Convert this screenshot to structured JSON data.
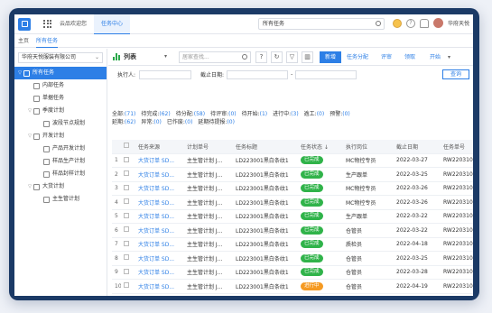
{
  "topbar": {
    "tabs": [
      "云品欢迎您",
      "任务中心"
    ],
    "search_value": "所有任务",
    "user_name": "华府天悦"
  },
  "subnav": {
    "items": [
      "主页",
      "所有任务"
    ]
  },
  "sidebar": {
    "company": "华府天悦服装有限公司",
    "tree": [
      {
        "label": "所有任务",
        "level": 0,
        "caret": "▽",
        "selected": true
      },
      {
        "label": "内部任务",
        "level": 1,
        "caret": ""
      },
      {
        "label": "单据任务",
        "level": 1,
        "caret": ""
      },
      {
        "label": "季度计划",
        "level": 1,
        "caret": "▽"
      },
      {
        "label": "波段节点规划",
        "level": 2,
        "caret": ""
      },
      {
        "label": "开发计划",
        "level": 1,
        "caret": "▽"
      },
      {
        "label": "产品开发计划",
        "level": 2,
        "caret": ""
      },
      {
        "label": "样品生产计划",
        "level": 2,
        "caret": ""
      },
      {
        "label": "样品封样计划",
        "level": 2,
        "caret": ""
      },
      {
        "label": "大货计划",
        "level": 1,
        "caret": "▽"
      },
      {
        "label": "主生管计划",
        "level": 2,
        "caret": ""
      }
    ]
  },
  "toolbar": {
    "title": "列表",
    "search_placeholder": "居家查找...",
    "new_label": "新增",
    "assign_label": "任务分配",
    "review_label": "评审",
    "claim_label": "领取",
    "start_label": "开始"
  },
  "filters": {
    "executor_label": "执行人:",
    "deadline_label": "截止日期:",
    "query_label": "查询"
  },
  "stats": {
    "row1": [
      "全部:",
      "(71)",
      "待完成:",
      "(62)",
      "待分配:",
      "(58)",
      "待评审:",
      "(0)",
      "待开始:",
      "(1)",
      "进行中:",
      "(3)",
      "逾工:",
      "(0)",
      "预警:",
      "(0)"
    ],
    "row2": [
      "延期:",
      "(62)",
      "异常:",
      "(0)",
      "已作废:",
      "(0)",
      "延期待提报:",
      "(0)"
    ]
  },
  "table": {
    "headers": [
      "",
      "",
      "任务来源",
      "计划单号",
      "任务标题",
      "任务状态 ↓",
      "执行岗位",
      "截止日期",
      "任务单号"
    ],
    "rows": [
      {
        "n": "1",
        "src": "大货订单 SD...",
        "plan": "主生管计划 J...",
        "title": "LD223001黑白条纹1",
        "status": "已完成",
        "pos": "MC物控专员",
        "date": "2022-03-27",
        "no": "RW2203100"
      },
      {
        "n": "2",
        "src": "大货订单 SD...",
        "plan": "主生管计划 J...",
        "title": "LD223001黑白条纹1",
        "status": "已完成",
        "pos": "生产跟单",
        "date": "2022-03-25",
        "no": "RW2203100"
      },
      {
        "n": "3",
        "src": "大货订单 SD...",
        "plan": "主生管计划 J...",
        "title": "LD223001黑白条纹1",
        "status": "已完成",
        "pos": "MC物控专员",
        "date": "2022-03-26",
        "no": "RW2203100"
      },
      {
        "n": "4",
        "src": "大货订单 SD...",
        "plan": "主生管计划 J...",
        "title": "LD223001黑白条纹1",
        "status": "已完成",
        "pos": "MC物控专员",
        "date": "2022-03-26",
        "no": "RW2203100"
      },
      {
        "n": "5",
        "src": "大货订单 SD...",
        "plan": "主生管计划 J...",
        "title": "LD223001黑白条纹1",
        "status": "已完成",
        "pos": "生产跟单",
        "date": "2022-03-22",
        "no": "RW2203100"
      },
      {
        "n": "6",
        "src": "大货订单 SD...",
        "plan": "主生管计划 J...",
        "title": "LD223001黑白条纹1",
        "status": "已完成",
        "pos": "仓管员",
        "date": "2022-03-22",
        "no": "RW2203100"
      },
      {
        "n": "7",
        "src": "大货订单 SD...",
        "plan": "主生管计划 J...",
        "title": "LD223001黑白条纹1",
        "status": "已完成",
        "pos": "质检员",
        "date": "2022-04-18",
        "no": "RW2203100"
      },
      {
        "n": "8",
        "src": "大货订单 SD...",
        "plan": "主生管计划 J...",
        "title": "LD223001黑白条纹1",
        "status": "已完成",
        "pos": "仓管员",
        "date": "2022-03-25",
        "no": "RW2203100"
      },
      {
        "n": "9",
        "src": "大货订单 SD...",
        "plan": "主生管计划 J...",
        "title": "LD223001黑白条纹1",
        "status": "已完成",
        "pos": "仓管员",
        "date": "2022-03-28",
        "no": "RW2203100"
      },
      {
        "n": "10",
        "src": "大货订单 SD...",
        "plan": "主生管计划 J...",
        "title": "LD223001黑白条纹1",
        "status": "进行中",
        "pos": "仓管员",
        "date": "2022-04-19",
        "no": "RW2203100"
      }
    ]
  },
  "colors": {
    "accent": "#2d7fe6",
    "done": "#30b34a",
    "in_progress": "#f59a23",
    "frame": "#1b3a66"
  }
}
